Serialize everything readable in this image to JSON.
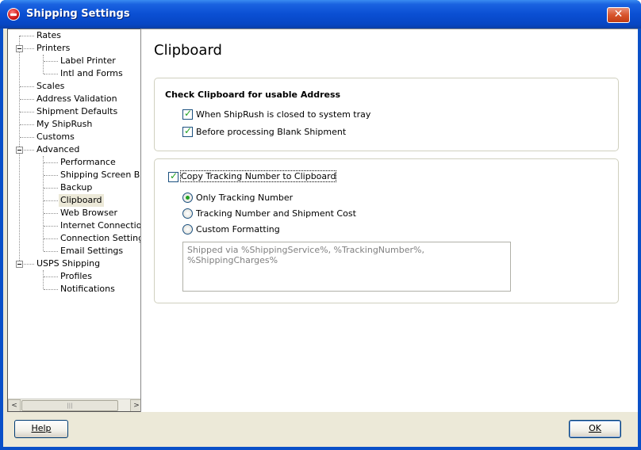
{
  "window": {
    "title": "Shipping Settings",
    "close_glyph": "✕"
  },
  "tree": {
    "items": [
      {
        "label": "Rates",
        "level": 0
      },
      {
        "label": "Printers",
        "level": 0,
        "expanded": true
      },
      {
        "label": "Label Printer",
        "level": 1
      },
      {
        "label": "Intl and Forms",
        "level": 1
      },
      {
        "label": "Scales",
        "level": 0
      },
      {
        "label": "Address Validation",
        "level": 0
      },
      {
        "label": "Shipment Defaults",
        "level": 0
      },
      {
        "label": "My ShipRush",
        "level": 0
      },
      {
        "label": "Customs",
        "level": 0
      },
      {
        "label": "Advanced",
        "level": 0,
        "expanded": true
      },
      {
        "label": "Performance",
        "level": 1
      },
      {
        "label": "Shipping Screen Beha",
        "level": 1
      },
      {
        "label": "Backup",
        "level": 1
      },
      {
        "label": "Clipboard",
        "level": 1,
        "selected": true
      },
      {
        "label": "Web Browser",
        "level": 1
      },
      {
        "label": "Internet Connection",
        "level": 1
      },
      {
        "label": "Connection Settings",
        "level": 1
      },
      {
        "label": "Email Settings",
        "level": 1
      },
      {
        "label": "USPS Shipping",
        "level": 0,
        "expanded": true
      },
      {
        "label": "Profiles",
        "level": 1
      },
      {
        "label": "Notifications",
        "level": 1
      }
    ],
    "scroll_left": "<",
    "scroll_right": ">",
    "thumb_grip": "|||"
  },
  "panel": {
    "title": "Clipboard",
    "check_group": {
      "title": "Check Clipboard for usable Address",
      "options": [
        {
          "label": "When ShipRush is closed to system tray",
          "checked": true
        },
        {
          "label": "Before processing Blank Shipment",
          "checked": true
        }
      ]
    },
    "copy_group": {
      "checkbox_label": "Copy Tracking Number to Clipboard",
      "checked": true,
      "radios": [
        {
          "label": "Only Tracking Number",
          "selected": true
        },
        {
          "label": "Tracking Number and Shipment Cost",
          "selected": false
        },
        {
          "label": "Custom Formatting",
          "selected": false
        }
      ],
      "format_text": "Shipped via %ShippingService%, %TrackingNumber%, %ShippingCharges%"
    }
  },
  "buttons": {
    "help": "Help",
    "ok": "OK"
  }
}
